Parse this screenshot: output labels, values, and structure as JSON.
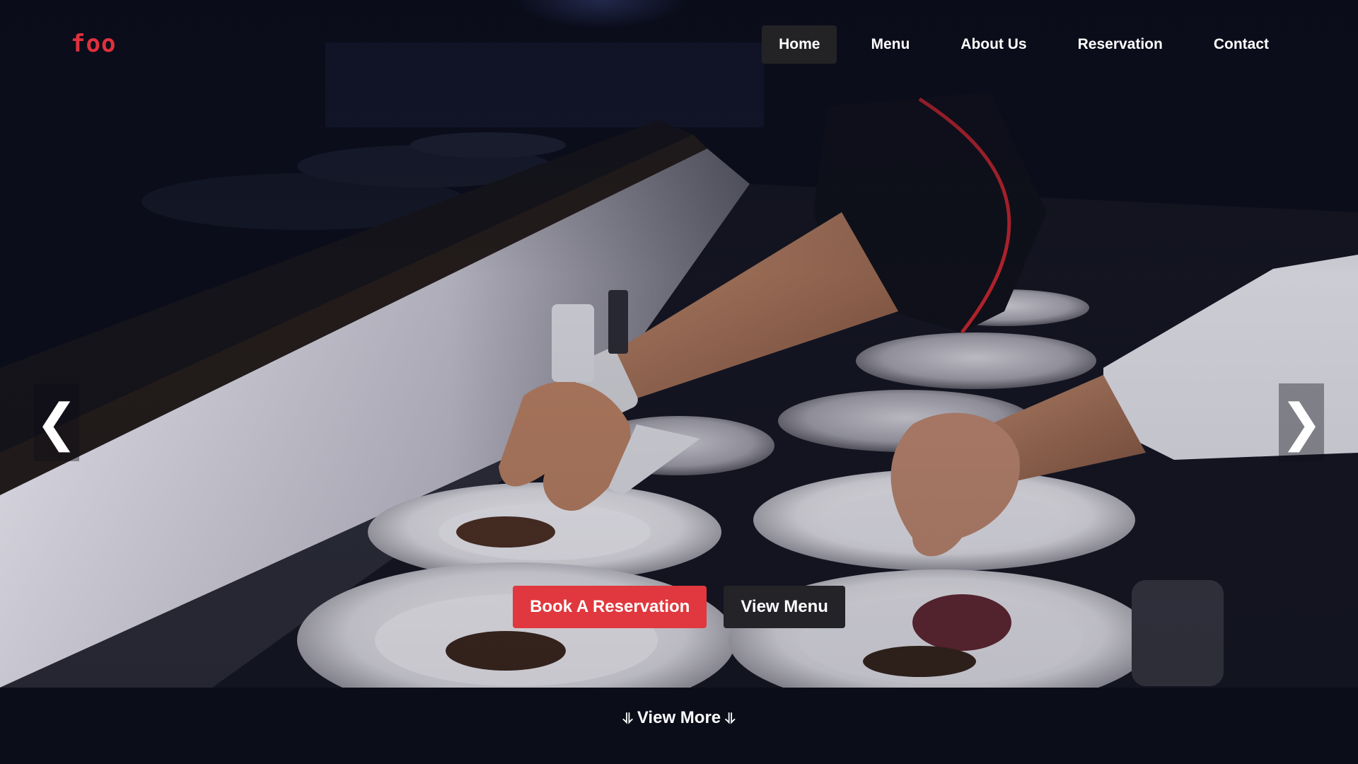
{
  "brand": {
    "logo_text": "foo",
    "accent_color": "#e0313c"
  },
  "nav": {
    "items": [
      {
        "label": "Home",
        "active": true
      },
      {
        "label": "Menu",
        "active": false
      },
      {
        "label": "About Us",
        "active": false
      },
      {
        "label": "Reservation",
        "active": false
      },
      {
        "label": "Contact",
        "active": false
      }
    ]
  },
  "hero": {
    "image": "chef-plating-dishes-photo",
    "prev_arrow": "❮",
    "next_arrow": "❯",
    "primary_button": "Book A Reservation",
    "secondary_button": "View Menu",
    "primary_color": "#e0383e",
    "secondary_color": "#232328"
  },
  "footer": {
    "view_more_label": "View More",
    "arrow_glyph": "⥥",
    "background": "#0b0d19"
  }
}
